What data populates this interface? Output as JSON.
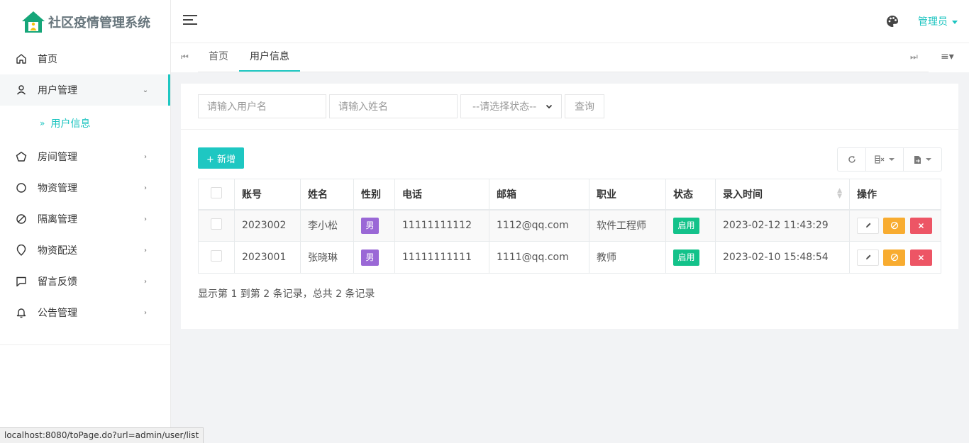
{
  "app": {
    "title": "社区疫情管理系统"
  },
  "sidebar": {
    "items": [
      {
        "label": "首页",
        "icon": "home-icon",
        "arrow": ""
      },
      {
        "label": "用户管理",
        "icon": "user-icon",
        "arrow": "⌄"
      },
      {
        "label": "房间管理",
        "icon": "pentagon-icon",
        "arrow": "›"
      },
      {
        "label": "物资管理",
        "icon": "circle-icon",
        "arrow": "›"
      },
      {
        "label": "隔离管理",
        "icon": "ban-icon",
        "arrow": "›"
      },
      {
        "label": "物资配送",
        "icon": "location-icon",
        "arrow": "›"
      },
      {
        "label": "留言反馈",
        "icon": "message-icon",
        "arrow": "›"
      },
      {
        "label": "公告管理",
        "icon": "bell-icon",
        "arrow": "›"
      }
    ],
    "submenu": {
      "chevron": "»",
      "label": "用户信息"
    }
  },
  "header": {
    "user": "管理员"
  },
  "tabs": [
    {
      "label": "首页",
      "active": false
    },
    {
      "label": "用户信息",
      "active": true
    }
  ],
  "search": {
    "username_placeholder": "请输入用户名",
    "name_placeholder": "请输入姓名",
    "status_placeholder": "--请选择状态--",
    "query_label": "查询"
  },
  "toolbar": {
    "add_label": "+ 新增"
  },
  "table": {
    "columns": [
      "账号",
      "姓名",
      "性别",
      "电话",
      "邮箱",
      "职业",
      "状态",
      "录入时间",
      "操作"
    ],
    "rows": [
      {
        "account": "2023002",
        "name": "李小松",
        "gender": "男",
        "phone": "11111111112",
        "email": "1112@qq.com",
        "job": "软件工程师",
        "status": "启用",
        "created": "2023-02-12 11:43:29"
      },
      {
        "account": "2023001",
        "name": "张晓琳",
        "gender": "男",
        "phone": "11111111111",
        "email": "1111@qq.com",
        "job": "教师",
        "status": "启用",
        "created": "2023-02-10 15:48:54"
      }
    ]
  },
  "pagination": {
    "info": "显示第 1 到第 2 条记录，总共 2 条记录"
  },
  "statusbar": {
    "url": "localhost:8080/toPage.do?url=admin/user/list"
  },
  "colors": {
    "accent": "#1ec7c2",
    "gender_badge": "#9a68d6",
    "status_badge": "#13c28a",
    "warn": "#f8ac30",
    "danger": "#ed5565"
  }
}
